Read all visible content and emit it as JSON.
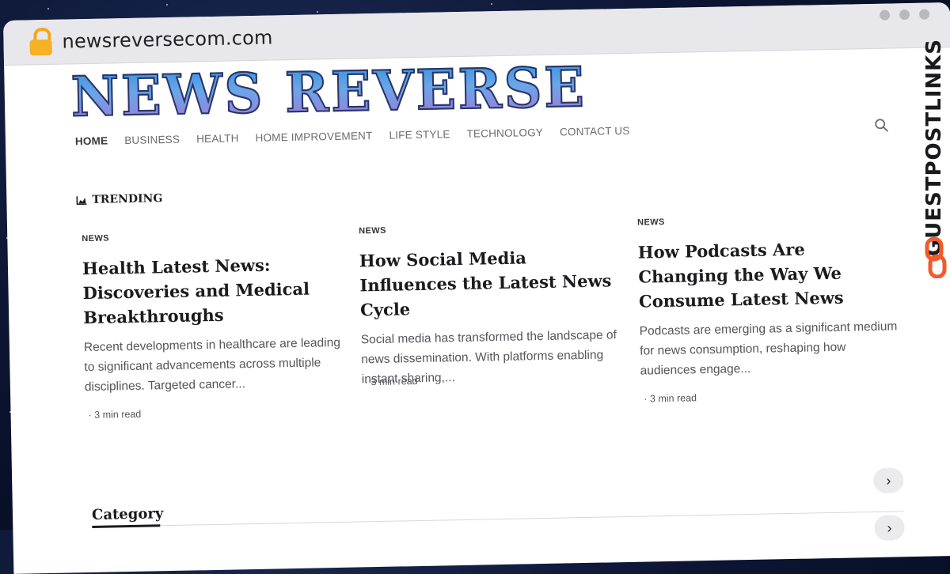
{
  "browser": {
    "url": "newsreversecom.com",
    "lock_icon": "lock-icon"
  },
  "site": {
    "logo": "NEWS REVERSE",
    "nav": [
      {
        "label": "HOME",
        "active": true
      },
      {
        "label": "BUSINESS"
      },
      {
        "label": "HEALTH"
      },
      {
        "label": "HOME IMPROVEMENT"
      },
      {
        "label": "LIFE STYLE"
      },
      {
        "label": "TECHNOLOGY"
      },
      {
        "label": "CONTACT US"
      }
    ],
    "search_icon": "search-icon"
  },
  "trending": {
    "heading": "TRENDING",
    "icon": "area-chart-icon",
    "articles": [
      {
        "tag": "NEWS",
        "title": "Health Latest News: Discoveries and Medical Breakthroughs",
        "excerpt": "Recent developments in healthcare are leading to significant advancements across multiple disciplines. Targeted cancer...",
        "meta": "· 3 min read"
      },
      {
        "tag": "NEWS",
        "title": "How Social Media Influences the Latest News Cycle",
        "excerpt": "Social media has transformed the landscape of news dissemination. With platforms enabling instant sharing,...",
        "meta": "· 3 min read"
      },
      {
        "tag": "NEWS",
        "title": "How Podcasts Are Changing the Way We Consume Latest News",
        "excerpt": "Podcasts are emerging as a significant medium for news consumption, reshaping how audiences engage...",
        "meta": "· 3 min read"
      }
    ]
  },
  "category": {
    "heading": "Category"
  },
  "watermark": {
    "text": "GUESTPOSTLINKS"
  },
  "colors": {
    "logo_gradient_top": "#2e8fe0",
    "logo_gradient_bottom": "#a276d8",
    "chain_icon": "#f25a2a",
    "lock": "#f6b124"
  }
}
